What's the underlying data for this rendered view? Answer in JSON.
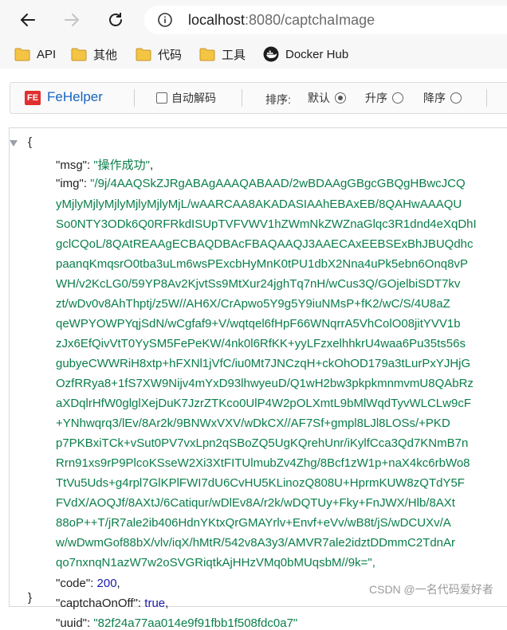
{
  "browser": {
    "url_host": "localhost",
    "url_rest": ":8080/captchaImage"
  },
  "bookmarks": [
    {
      "label": "API",
      "icon": "folder-icon"
    },
    {
      "label": "其他",
      "icon": "folder-icon"
    },
    {
      "label": "代码",
      "icon": "folder-icon"
    },
    {
      "label": "工具",
      "icon": "folder-icon"
    },
    {
      "label": "Docker Hub",
      "icon": "docker-icon"
    }
  ],
  "fehelper": {
    "title": "FeHelper",
    "logo": "FE",
    "auto_decode_label": "自动解码",
    "sort_label": "排序:",
    "sort_options": [
      {
        "label": "默认",
        "selected": true
      },
      {
        "label": "升序",
        "selected": false
      },
      {
        "label": "降序",
        "selected": false
      }
    ]
  },
  "json": {
    "open_brace": "{",
    "close_brace": "}",
    "msg_key": "\"msg\":",
    "msg_value": "\"操作成功\"",
    "img_key": "\"img\":",
    "img_lines": [
      "\"/9j/4AAQSkZJRgABAgAAAQABAAD/2wBDAAgGBgcGBQgHBwcJCQ",
      "yMjlyMjlyMjlyMjlyMjlyMjL/wAARCAA8AKADASIAAhEBAxEB/8QAHwAAAQU",
      "So0NTY3ODk6Q0RFRkdISUpTVFVWV1hZWmNkZWZnaGlqc3R1dnd4eXqDhI",
      "gclCQoL/8QAtREAAgECBAQDBAcFBAQAAQJ3AAECAxEEBSExBhJBUQdhc",
      "paanqKmqsrO0tba3uLm6wsPExcbHyMnK0tPU1dbX2Nna4uPk5ebn6Onq8vP",
      "WH/v2KcLG0/59YP8Av2KjvtSs9MtXur24jghTq7nH/wCus3Q/GOjelbiSDT7kv",
      "zt/wDv0v8AhThptj/z5W//AH6X/CrApwo5Y9g5Y9iuNMsP+fK2/wC/S/4U8aZ",
      "qeWPYOWPYqjSdN/wCgfaf9+V/wqtqel6fHpF66WNqrrA5VhColO08jitYVV1b",
      "zJx6EfQivVtT0YySM5FePeKW/4nk0l6RfKK+yyLFzxelhhkrU4waa6Pu35ts56s",
      "gubyeCWWRiH8xtp+hFXNl1jVfC/iu0Mt7JNCzqH+ckOhOD179a3tLurPxYJHjG",
      "OzfRRya8+1fS7XW9Nijv4mYxD93lhwyeuD/Q1wH2bw3pkpkmnmvmU8QAbRz",
      "aXDqlrHfW0glglXejDuK7JzrZTKco0UlP4W2pOLXmtL9bMlWqdTyvWLCLw9cF",
      "+YNhwqrq3/lEv/8Ar2k/9BNWxVXV/wDkCX//AF7Sf+gmpl8LJl8LOSs/+PKD",
      "p7PKBxiTCk+vSut0PV7vxLpn2qSBoZQ5UgKQrehUnr/iKylfCca3Qd7KNmB7n",
      "Rrn91xs9rP9PlcoKSseW2Xi3XtFITUlmubZv4Zhg/8Bcf1zW1p+naX4kc6rbWo8",
      "TtVu5Uds+g4rpl7GlKPlFWI7dU6CvHU5KLinozQ808U+HprmKUW8zQTdY5F",
      "FVdX/AOQJf/8AXtJ/6Catiqur/wDlEv8A/r2k/wDQTUy+Fky+FnJWX/Hlb/8AXt",
      "88oP++T/jR7ale2ib406HdnYKtxQrGMAYrlv+Envf+eVv/wB8t/jS/wDCUXv/A",
      "w/wDwmGof88bX/vlv/iqX/hMtR/542v8A3y3/AMVR7ale2idztDDmmC2TdnAr",
      "qo7nxnqN1azW7w2oSVGRiqtkAjHHzVMq0bMUqsbM//9k=\","
    ],
    "code_key": "\"code\":",
    "code_value": "200",
    "captcha_key": "\"captchaOnOff\":",
    "captcha_value": "true",
    "uuid_key": "\"uuid\":",
    "uuid_value": "\"82f24a77aa014e9f91fbb1f508fdc0a7\""
  },
  "watermark": "CSDN @一名代码爱好者"
}
